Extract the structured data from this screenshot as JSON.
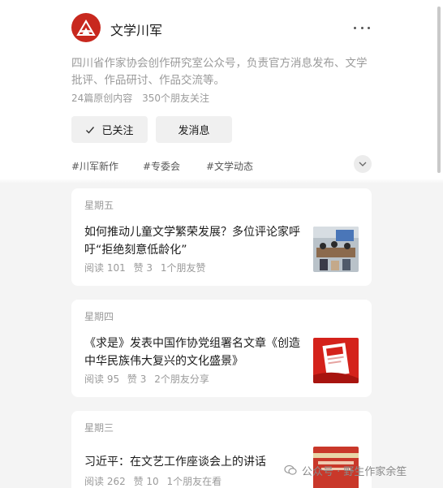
{
  "account": {
    "name": "文学川军",
    "description": "四川省作家协会创作研究室公众号，负责官方消息发布、文学批评、作品研讨、作品交流等。",
    "original_count": "24篇原创内容",
    "followers": "350个朋友关注"
  },
  "buttons": {
    "follow": "已关注",
    "message": "发消息"
  },
  "tags": [
    "#川军新作",
    "#专委会",
    "#文学动态"
  ],
  "articles": [
    {
      "day": "星期五",
      "title": "如何推动儿童文学繁荣发展？多位评论家呼吁“拒绝刻意低龄化”",
      "reads": "阅读 101",
      "likes": "赞 3",
      "social": "1个朋友赞"
    },
    {
      "day": "星期四",
      "title": "《求是》发表中国作协党组署名文章《创造中华民族伟大复兴的文化盛景》",
      "reads": "阅读 95",
      "likes": "赞 3",
      "social": "2个朋友分享"
    },
    {
      "day": "星期三",
      "title": "习近平：在文艺工作座谈会上的讲话",
      "reads": "阅读 262",
      "likes": "赞 10",
      "social": "1个朋友在看"
    }
  ],
  "watermark": "公众号 · 野生作家余笙",
  "colors": {
    "brand_red": "#c8281e",
    "background": "#f4f4f4"
  }
}
